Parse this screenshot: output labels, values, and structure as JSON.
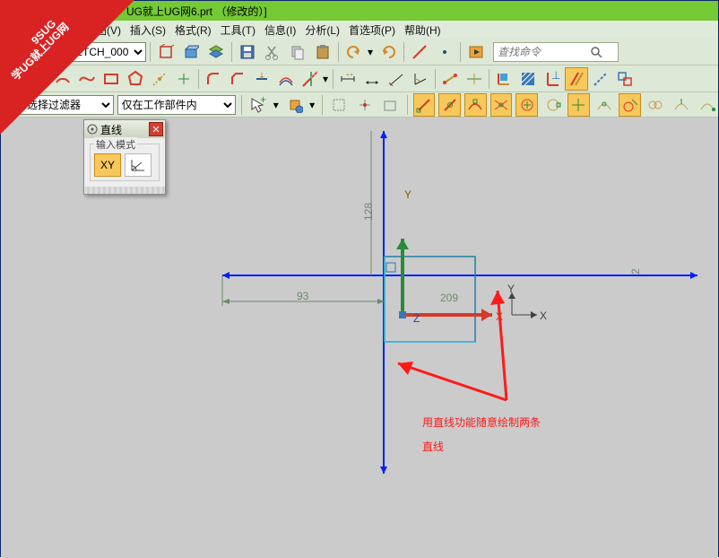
{
  "title": "UG就上UG网6.prt （修改的）]",
  "menu": {
    "view": "视图(V)",
    "insert": "插入(S)",
    "format": "格式(R)",
    "tools": "工具(T)",
    "info": "信息(I)",
    "analyze": "分析(L)",
    "options": "首选项(P)",
    "help": "帮助(H)"
  },
  "sketch_combo": "SKETCH_000",
  "filter_label": "有选择过滤器",
  "filter_scope": "仅在工作部件内",
  "search_placeholder": "查找命令",
  "dialog": {
    "title": "直线",
    "group": "输入模式",
    "opt_xy": "XY"
  },
  "dims": {
    "d93": "93",
    "d128": "128",
    "d209": "209",
    "d2": "2 ",
    "d1": ""
  },
  "axis": {
    "x1": "X",
    "y1": "Y",
    "x2": "X",
    "y2": "Y",
    "z": "Z"
  },
  "annot": {
    "line1": "用直线功能随意绘制两条",
    "line2": "直线"
  }
}
